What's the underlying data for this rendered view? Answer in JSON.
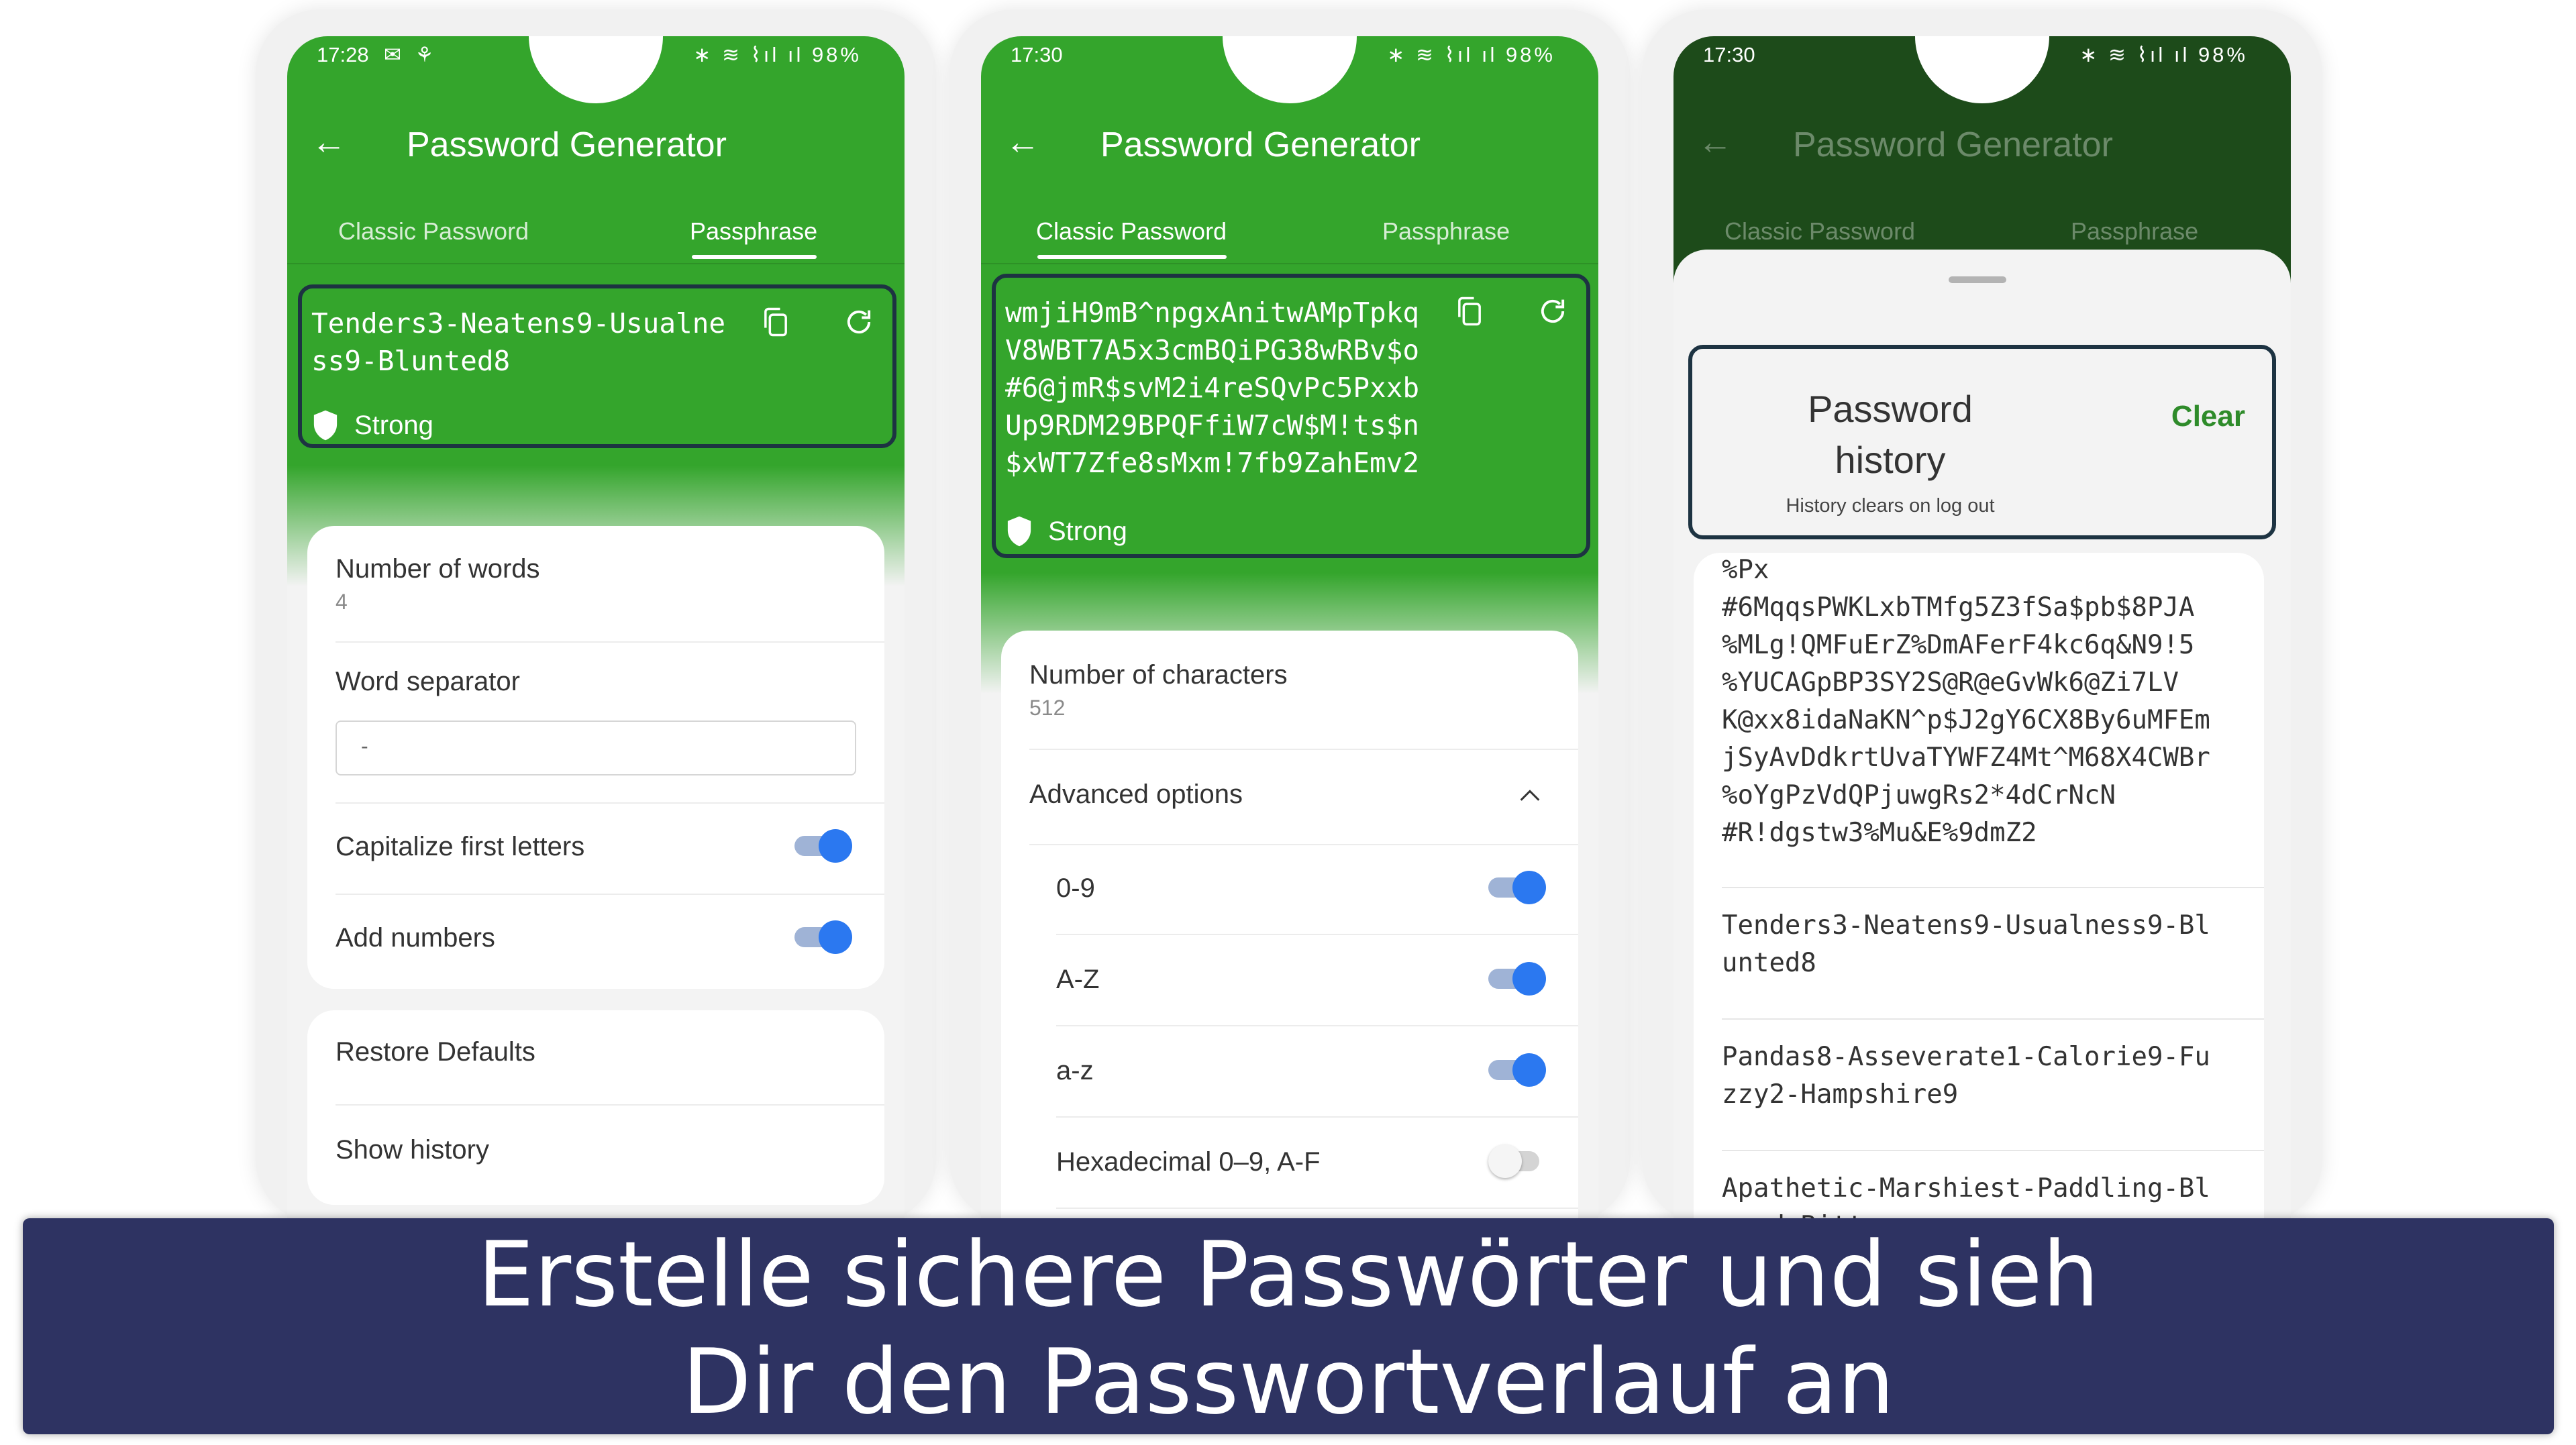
{
  "screens": [
    {
      "status": {
        "time": "17:28",
        "left_icons": "✉ ⚘",
        "right_icons": "∗ ≋ ⌇ıl ıl 98%"
      },
      "appbar": {
        "back_icon": "arrow-left-icon",
        "title": "Password Generator"
      },
      "tabs": [
        {
          "label": "Classic Password",
          "active": false
        },
        {
          "label": "Passphrase",
          "active": true
        }
      ],
      "password": {
        "value": "Tenders3-Neatens9-Usualne\nss9-Blunted8",
        "strength": "Strong"
      },
      "settings": {
        "number_of_words_label": "Number of words",
        "number_of_words_value": "4",
        "word_separator_label": "Word separator",
        "word_separator_value": "-",
        "capitalize_label": "Capitalize first letters",
        "capitalize_on": true,
        "add_numbers_label": "Add numbers",
        "add_numbers_on": true
      },
      "actions": {
        "restore_defaults": "Restore Defaults",
        "show_history": "Show history"
      }
    },
    {
      "status": {
        "time": "17:30",
        "right_icons": "∗ ≋ ⌇ıl ıl 98%"
      },
      "appbar": {
        "back_icon": "arrow-left-icon",
        "title": "Password Generator"
      },
      "tabs": [
        {
          "label": "Classic Password",
          "active": true
        },
        {
          "label": "Passphrase",
          "active": false
        }
      ],
      "password": {
        "value": "wmjiH9mB^npgxAnitwAMpTpkq\nV8WBT7A5x3cmBQiPG38wRBv$o\n#6@jmR$svM2i4reSQvPc5Pxxb\nUp9RDM29BPQFfiW7cW$M!ts$n\n$xWT7Zfe8sMxm!7fb9ZahEmv2",
        "strength": "Strong"
      },
      "settings": {
        "number_of_characters_label": "Number of characters",
        "number_of_characters_value": "512",
        "advanced_options_label": "Advanced options",
        "options": [
          {
            "label": "0-9",
            "on": true
          },
          {
            "label": "A-Z",
            "on": true
          },
          {
            "label": "a-z",
            "on": true
          },
          {
            "label": "Hexadecimal 0–9, A-F",
            "on": false
          }
        ]
      }
    },
    {
      "status": {
        "time": "17:30",
        "right_icons": "∗ ≋ ⌇ıl ıl 98%"
      },
      "appbar": {
        "back_icon": "arrow-left-icon",
        "title": "Password Generator"
      },
      "tabs": [
        {
          "label": "Classic Password",
          "active": true
        },
        {
          "label": "Passphrase",
          "active": false
        }
      ],
      "history": {
        "title": "Password\nhistory",
        "clear_label": "Clear",
        "subtitle": "History clears on log out",
        "items": [
          "%Px\n#6MqqsPWKLxbTMfg5Z3fSa$pb$8PJA\n%MLg!QMFuErZ%DmAFerF4kc6q&N9!5\n%YUCAGpBP3SY2S@R@eGvWk6@Zi7LV\nK@xx8idaNaKN^p$J2gY6CX8By6uMFEm\njSyAvDdkrtUvaTYWFZ4Mt^M68X4CWBr\n%oYgPzVdQPjuwgRs2*4dCrNcN\n#R!dgstw3%Mu&E%9dmZ2",
          "Tenders3-Neatens9-Usualness9-Bl\nunted8",
          "Pandas8-Asseverate1-Calorie9-Fu\nzzy2-Hampshire9",
          "Apathetic-Marshiest-Paddling-Bl\nazed-Bitterness"
        ]
      }
    }
  ],
  "caption": {
    "line1": "Erstelle sichere Passwörter und sieh",
    "line2": "Dir den Passwortverlauf an"
  },
  "colors": {
    "brand_green": "#34a52c",
    "highlight_border": "#1d3342",
    "toggle_on": "#2b78f0",
    "clear_green": "#2e8b2a",
    "caption_bg": "#2e3362"
  }
}
